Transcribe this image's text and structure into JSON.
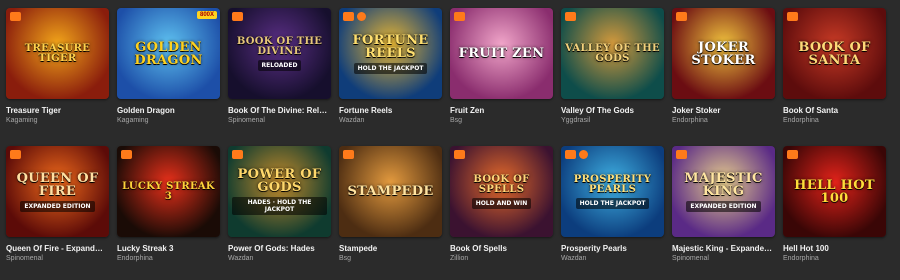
{
  "games": [
    {
      "name": "Treasure Tiger",
      "provider": "Kagaming",
      "art_title": "Treasure Tiger",
      "art_sub": "",
      "tag": "",
      "bg": "#8a1d0c",
      "bg2": "#f2a51a",
      "text": "#ffd34d",
      "badges": [
        "new"
      ]
    },
    {
      "name": "Golden Dragon",
      "provider": "Kagaming",
      "art_title": "Golden Dragon",
      "art_sub": "",
      "tag": "800X",
      "bg": "#1d4fa8",
      "bg2": "#5ec1f0",
      "text": "#ffd21f",
      "badges": []
    },
    {
      "name": "Book Of The Divine: Rel…",
      "provider": "Spinomenal",
      "art_title": "Book of the Divine",
      "art_sub": "Reloaded",
      "tag": "",
      "bg": "#160f2d",
      "bg2": "#5b2f86",
      "text": "#e7c77a",
      "badges": [
        "new"
      ]
    },
    {
      "name": "Fortune Reels",
      "provider": "Wazdan",
      "art_title": "Fortune Reels",
      "art_sub": "Hold the Jackpot",
      "tag": "",
      "bg": "#0f3d7a",
      "bg2": "#e8b633",
      "text": "#ffdf6e",
      "badges": [
        "new",
        "hot"
      ]
    },
    {
      "name": "Fruit Zen",
      "provider": "Bsg",
      "art_title": "Fruit Zen",
      "art_sub": "",
      "tag": "",
      "bg": "#8a2d6e",
      "bg2": "#f1a5c9",
      "text": "#ffffff",
      "badges": [
        "new"
      ]
    },
    {
      "name": "Valley Of The Gods",
      "provider": "Yggdrasil",
      "art_title": "Valley of the Gods",
      "art_sub": "",
      "tag": "",
      "bg": "#0e4d4a",
      "bg2": "#d59a3c",
      "text": "#f4d27c",
      "badges": [
        "new"
      ]
    },
    {
      "name": "Joker Stoker",
      "provider": "Endorphina",
      "art_title": "Joker Stoker",
      "art_sub": "",
      "tag": "",
      "bg": "#6b0d12",
      "bg2": "#f0c23d",
      "text": "#ffffff",
      "badges": [
        "new"
      ]
    },
    {
      "name": "Book Of Santa",
      "provider": "Endorphina",
      "art_title": "Book of Santa",
      "art_sub": "",
      "tag": "",
      "bg": "#5d0c0c",
      "bg2": "#c83a25",
      "text": "#ffd978",
      "badges": [
        "new"
      ]
    },
    {
      "name": "Queen Of Fire - Expand…",
      "provider": "Spinomenal",
      "art_title": "Queen of Fire",
      "art_sub": "Expanded Edition",
      "tag": "",
      "bg": "#5c0b08",
      "bg2": "#f06a1b",
      "text": "#ffe0a3",
      "badges": [
        "new"
      ]
    },
    {
      "name": "Lucky Streak 3",
      "provider": "Endorphina",
      "art_title": "Lucky Streak 3",
      "art_sub": "",
      "tag": "",
      "bg": "#1a0b06",
      "bg2": "#e7301a",
      "text": "#ffd33a",
      "badges": [
        "new"
      ]
    },
    {
      "name": "Power Of Gods: Hades",
      "provider": "Wazdan",
      "art_title": "Power of Gods",
      "art_sub": "Hades · Hold the Jackpot",
      "tag": "",
      "bg": "#0f3b2f",
      "bg2": "#c48b2b",
      "text": "#ffd86b",
      "badges": [
        "new"
      ]
    },
    {
      "name": "Stampede",
      "provider": "Bsg",
      "art_title": "Stampede",
      "art_sub": "",
      "tag": "",
      "bg": "#4d2d12",
      "bg2": "#e39a3e",
      "text": "#ffe3a0",
      "badges": [
        "new"
      ]
    },
    {
      "name": "Book Of Spells",
      "provider": "Zillion",
      "art_title": "Book of Spells",
      "art_sub": "Hold and Win",
      "tag": "",
      "bg": "#3b1230",
      "bg2": "#e56a2a",
      "text": "#ffd77a",
      "badges": [
        "new"
      ]
    },
    {
      "name": "Prosperity Pearls",
      "provider": "Wazdan",
      "art_title": "Prosperity Pearls",
      "art_sub": "Hold the Jackpot",
      "tag": "",
      "bg": "#0c3d7d",
      "bg2": "#3fb0e2",
      "text": "#ffe07a",
      "badges": [
        "new",
        "hot"
      ]
    },
    {
      "name": "Majestic King - Expande…",
      "provider": "Spinomenal",
      "art_title": "Majestic King",
      "art_sub": "Expanded Edition",
      "tag": "",
      "bg": "#5a2a86",
      "bg2": "#e7cd8d",
      "text": "#ffe5a1",
      "badges": [
        "new"
      ]
    },
    {
      "name": "Hell Hot 100",
      "provider": "Endorphina",
      "art_title": "Hell Hot 100",
      "art_sub": "",
      "tag": "",
      "bg": "#3a0606",
      "bg2": "#e3231a",
      "text": "#ffdd3a",
      "badges": [
        "new"
      ]
    }
  ],
  "badge_labels": {
    "new": "NEW",
    "hot": "🔥"
  }
}
